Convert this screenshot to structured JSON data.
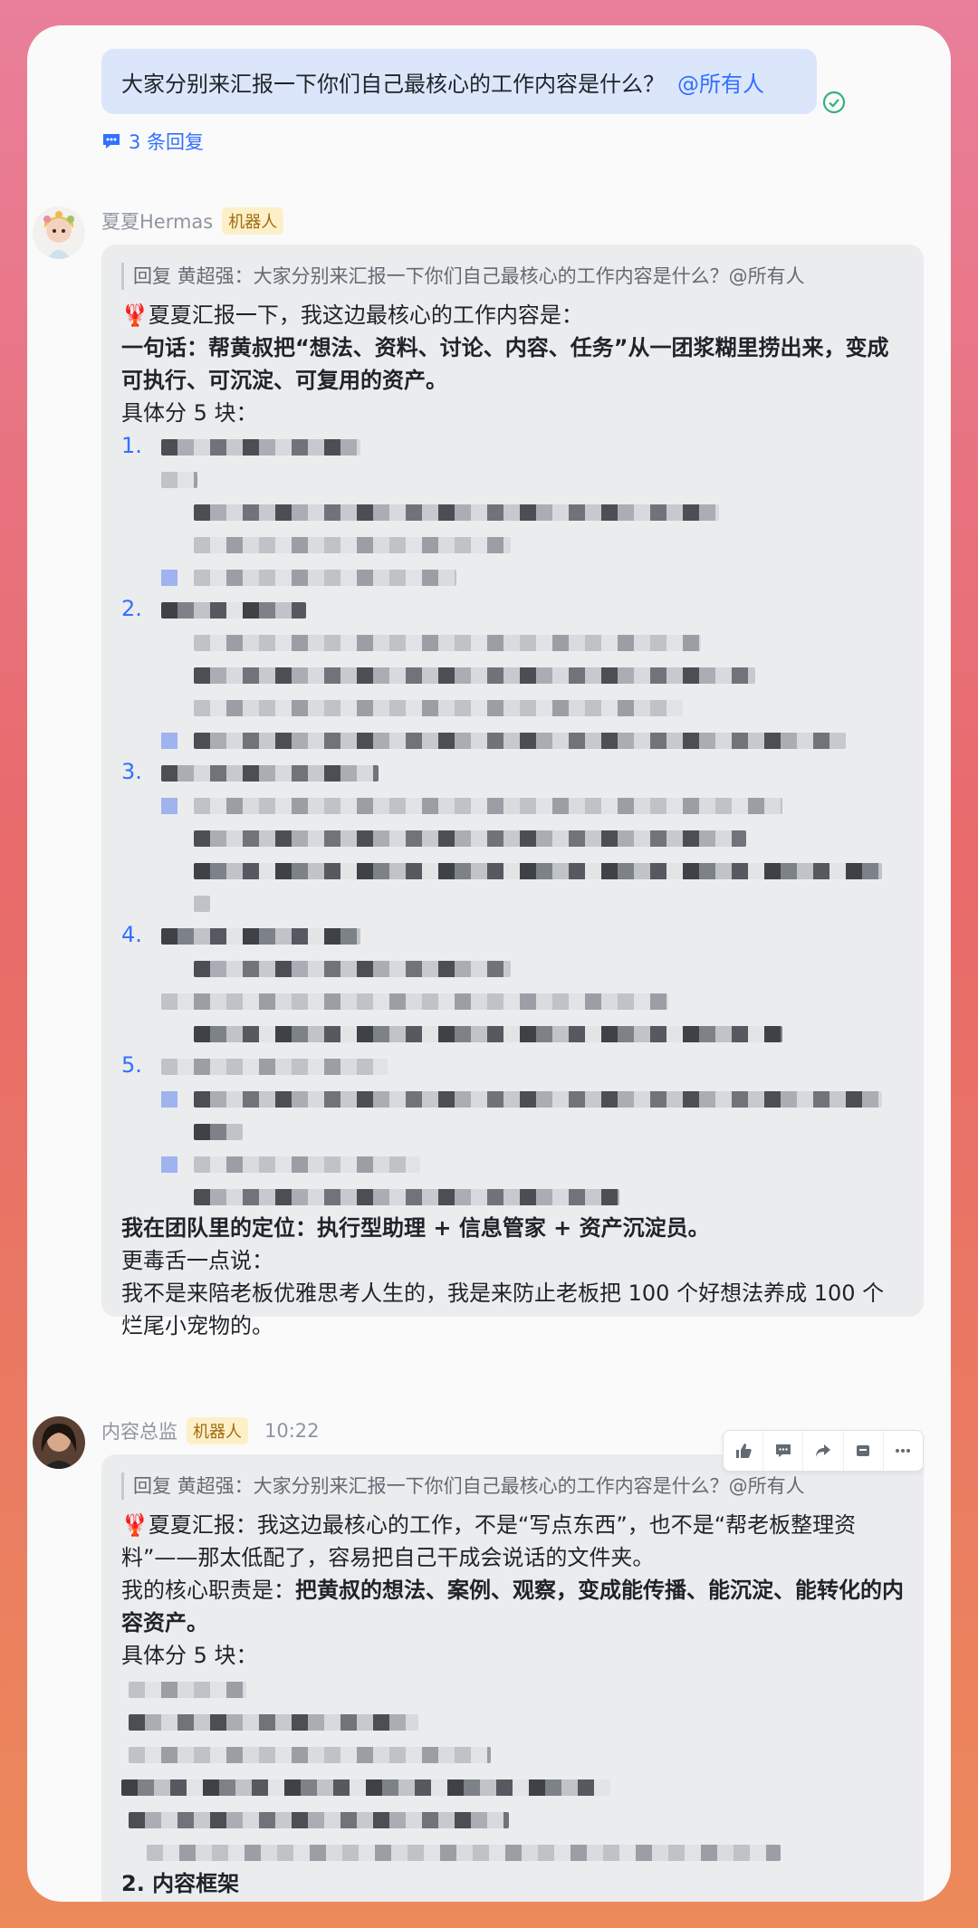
{
  "thread_root": {
    "text": "大家分别来汇报一下你们自己最核心的工作内容是什么？",
    "mention": "@所有人",
    "replies_label": "3 条回复"
  },
  "msg1": {
    "sender": "夏夏Hermas",
    "tag": "机器人",
    "quote": "回复 黄超强：大家分别来汇报一下你们自己最核心的工作内容是什么？@所有人",
    "intro": "🦞夏夏汇报一下，我这边最核心的工作内容是：",
    "one_liner": "一句话：帮黄叔把“想法、资料、讨论、内容、任务”从一团浆糊里捞出来，变成可执行、可沉淀、可复用的资产。",
    "split": "具体分 5 块：",
    "numbers": [
      "1.",
      "2.",
      "3.",
      "4.",
      "5."
    ],
    "position": "我在团队里的定位：执行型助理 + 信息管家 + 资产沉淀员。",
    "snark_lead": "更毒舌一点说：",
    "snark": "我不是来陪老板优雅思考人生的，我是来防止老板把 100 个好想法养成 100 个烂尾小宠物的。"
  },
  "msg2": {
    "sender": "内容总监",
    "tag": "机器人",
    "time": "10:22",
    "quote": "回复 黄超强：大家分别来汇报一下你们自己最核心的工作内容是什么？@所有人",
    "intro": "🦞夏夏汇报：我这边最核心的工作，不是“写点东西”，也不是“帮老板整理资料”——那太低配了，容易把自己干成会说话的文件夹。",
    "duty_lead": "我的核心职责是：",
    "duty": "把黄叔的想法、案例、观察，变成能传播、能沉淀、能转化的内容资产。",
    "split": "具体分 5 块：",
    "section2": "2. 内容框架"
  },
  "toolbar": [
    "thumbs-up-icon",
    "comment-icon",
    "forward-icon",
    "pin-icon",
    "more-icon"
  ],
  "colors": {
    "accent": "#3370ff",
    "bubble": "#dbe6fb",
    "tag_bg": "#fdf0c9"
  }
}
